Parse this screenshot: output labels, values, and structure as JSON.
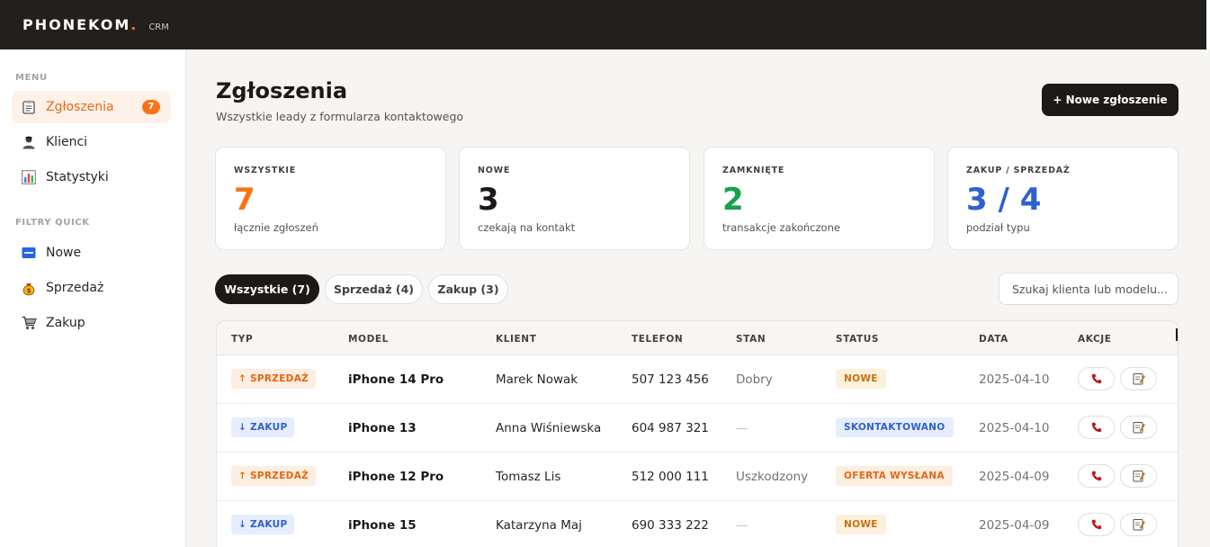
{
  "app": {
    "brand": "PHONEKOM",
    "brand_dot": ".",
    "brand_sub": "CRM"
  },
  "colors": {
    "accent": "#f97316",
    "dark": "#1c1917",
    "green": "#16a34a",
    "blue": "#2f5fd0"
  },
  "sidebar": {
    "menu_label": "MENU",
    "items": [
      {
        "label": "Zgłoszenia",
        "icon": "clipboard-icon",
        "badge": "7",
        "active": true
      },
      {
        "label": "Klienci",
        "icon": "person-icon"
      },
      {
        "label": "Statystyki",
        "icon": "bar-chart-icon"
      }
    ],
    "filters_label": "FILTRY QUICK",
    "filters": [
      {
        "label": "Nowe",
        "icon": "new-icon"
      },
      {
        "label": "Sprzedaż",
        "icon": "money-bag-icon"
      },
      {
        "label": "Zakup",
        "icon": "cart-icon"
      }
    ]
  },
  "header": {
    "title": "Zgłoszenia",
    "subtitle": "Wszystkie leady z formularza kontaktowego",
    "new_button": "+ Nowe zgłoszenie"
  },
  "stats": [
    {
      "label": "WSZYSTKIE",
      "value": "7",
      "note": "łącznie zgłoszeń",
      "color": "#f97316"
    },
    {
      "label": "NOWE",
      "value": "3",
      "note": "czekają na kontakt",
      "color": "#1c1917"
    },
    {
      "label": "ZAMKNIĘTE",
      "value": "2",
      "note": "transakcje zakończone",
      "color": "#16a34a"
    },
    {
      "label": "ZAKUP / SPRZEDAŻ",
      "value": "3 / 4",
      "note": "podział typu",
      "color": "#2f5fd0"
    }
  ],
  "tabs": [
    {
      "label": "Wszystkie (7)",
      "active": true
    },
    {
      "label": "Sprzedaż (4)"
    },
    {
      "label": "Zakup (3)"
    }
  ],
  "search": {
    "placeholder": "Szukaj klienta lub modelu..."
  },
  "table": {
    "columns": [
      "TYP",
      "MODEL",
      "KLIENT",
      "TELEFON",
      "STAN",
      "STATUS",
      "DATA",
      "AKCJE"
    ],
    "rows": [
      {
        "type": "↑ SPRZEDAŻ",
        "type_kind": "sell",
        "model": "iPhone 14 Pro",
        "client": "Marek Nowak",
        "phone": "507 123 456",
        "condition": "Dobry",
        "status": "NOWE",
        "status_kind": "new",
        "date": "2025-04-10"
      },
      {
        "type": "↓ ZAKUP",
        "type_kind": "buy",
        "model": "iPhone 13",
        "client": "Anna Wiśniewska",
        "phone": "604 987 321",
        "condition": "—",
        "status": "SKONTAKTOWANO",
        "status_kind": "contacted",
        "date": "2025-04-10"
      },
      {
        "type": "↑ SPRZEDAŻ",
        "type_kind": "sell",
        "model": "iPhone 12 Pro",
        "client": "Tomasz Lis",
        "phone": "512 000 111",
        "condition": "Uszkodzony",
        "status": "OFERTA WYSŁANA",
        "status_kind": "offer",
        "date": "2025-04-09"
      },
      {
        "type": "↓ ZAKUP",
        "type_kind": "buy",
        "model": "iPhone 15",
        "client": "Katarzyna Maj",
        "phone": "690 333 222",
        "condition": "—",
        "status": "NOWE",
        "status_kind": "new",
        "date": "2025-04-09"
      }
    ]
  }
}
